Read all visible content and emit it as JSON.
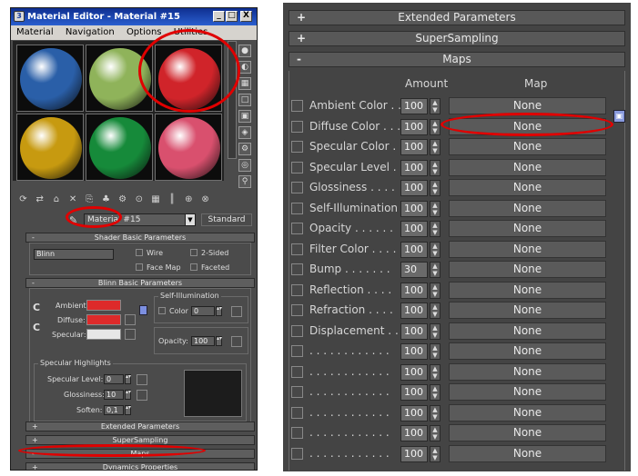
{
  "left_window": {
    "title": "Material Editor - Material #15",
    "app_icon": "3ds-max-icon",
    "window_buttons": [
      "_",
      "□",
      "X"
    ],
    "menu": [
      "Material",
      "Navigation",
      "Options",
      "Utilities"
    ],
    "slots": [
      {
        "name": "blue-sky",
        "color": "#2a5fa8"
      },
      {
        "name": "light-green",
        "color": "#8fb35a"
      },
      {
        "name": "red",
        "color": "#d0242a"
      },
      {
        "name": "gold",
        "color": "#c79a10"
      },
      {
        "name": "green",
        "color": "#168a3a"
      },
      {
        "name": "pink",
        "color": "#d9506e"
      }
    ],
    "toolbar_icons": [
      "get-material-icon",
      "put-to-scene-icon",
      "assign-icon",
      "reset-icon",
      "copy-icon",
      "unique-icon",
      "library-icon",
      "effects-channel-icon",
      "show-map-icon",
      "show-end-icon",
      "go-parent-icon",
      "go-sibling-icon"
    ],
    "toolbar_glyphs": [
      "⟳",
      "⇄",
      "⌂",
      "✕",
      "⎘",
      "♣",
      "⚙",
      "⊙",
      "▦",
      "║",
      "⊕",
      "⊗"
    ],
    "material_name": "Material #15",
    "material_type": "Standard",
    "shader_basic": {
      "title": "Shader Basic Parameters",
      "shader": "Blinn",
      "wire": "Wire",
      "two_sided": "2-Sided",
      "face_map": "Face Map",
      "faceted": "Faceted"
    },
    "blinn_basic": {
      "title": "Blinn Basic Parameters",
      "self_illum_title": "Self-Illumination",
      "color_label": "Color",
      "self_illum_value": "0",
      "ambient": "Ambient:",
      "diffuse": "Diffuse:",
      "specular": "Specular:",
      "opacity_label": "Opacity:",
      "opacity_value": "100",
      "ambient_color": "#dd2a2a",
      "diffuse_color": "#dd2a2a",
      "specular_color": "#e6e6e6",
      "lock_letter": "C"
    },
    "specular_highlights": {
      "title": "Specular Highlights",
      "specular_level_label": "Specular Level:",
      "specular_level": "0",
      "glossiness_label": "Glossiness:",
      "glossiness": "10",
      "soften_label": "Soften:",
      "soften": "0,1"
    },
    "rollouts": [
      {
        "sign": "+",
        "label": "Extended Parameters"
      },
      {
        "sign": "+",
        "label": "SuperSampling"
      },
      {
        "sign": "-",
        "label": "Maps"
      },
      {
        "sign": "+",
        "label": "Dynamics Properties"
      }
    ]
  },
  "right_panel": {
    "rollouts": [
      {
        "sign": "+",
        "label": "Extended Parameters"
      },
      {
        "sign": "+",
        "label": "SuperSampling"
      },
      {
        "sign": "-",
        "label": "Maps"
      }
    ],
    "amount_header": "Amount",
    "map_header": "Map",
    "rows": [
      {
        "label": "Ambient Color . .",
        "amount": "100",
        "map": "None"
      },
      {
        "label": "Diffuse Color . . .",
        "amount": "100",
        "map": "None"
      },
      {
        "label": "Specular Color  .",
        "amount": "100",
        "map": "None"
      },
      {
        "label": "Specular Level  .",
        "amount": "100",
        "map": "None"
      },
      {
        "label": "Glossiness . . . .",
        "amount": "100",
        "map": "None"
      },
      {
        "label": "Self-Illumination .",
        "amount": "100",
        "map": "None"
      },
      {
        "label": "Opacity . . . . . .",
        "amount": "100",
        "map": "None"
      },
      {
        "label": "Filter Color  . . . .",
        "amount": "100",
        "map": "None"
      },
      {
        "label": "Bump  . . . . . . .",
        "amount": "30",
        "map": "None"
      },
      {
        "label": "Reflection  . . . .",
        "amount": "100",
        "map": "None"
      },
      {
        "label": "Refraction  . . . .",
        "amount": "100",
        "map": "None"
      },
      {
        "label": "Displacement  . .",
        "amount": "100",
        "map": "None"
      },
      {
        "label": ". . . . . . . . . . . .",
        "amount": "100",
        "map": "None"
      },
      {
        "label": ". . . . . . . . . . . .",
        "amount": "100",
        "map": "None"
      },
      {
        "label": ". . . . . . . . . . . .",
        "amount": "100",
        "map": "None"
      },
      {
        "label": ". . . . . . . . . . . .",
        "amount": "100",
        "map": "None"
      },
      {
        "label": ". . . . . . . . . . . .",
        "amount": "100",
        "map": "None"
      },
      {
        "label": ". . . . . . . . . . . .",
        "amount": "100",
        "map": "None"
      }
    ],
    "lock_icon": "lock-icon"
  }
}
